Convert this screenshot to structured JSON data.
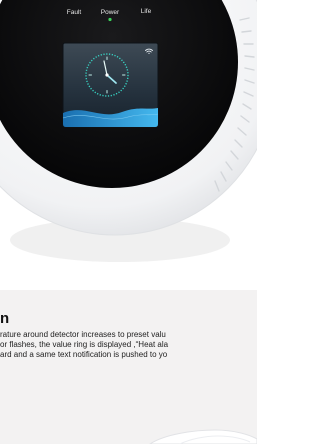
{
  "device": {
    "indicators": [
      {
        "label": "Fault"
      },
      {
        "label": "Power",
        "led_color": "#3bd35a"
      },
      {
        "label": "Life"
      }
    ],
    "screen": {
      "icon": "wifi-icon",
      "clock_icon": "analog-clock-icon"
    },
    "colors": {
      "housing": "#f4f5f7",
      "face": "#0b0b0d",
      "screen_accent": "#1e88c9"
    }
  },
  "info": {
    "title": "n",
    "lines": [
      "rature around detector increases to preset valu",
      "or flashes, the value ring is displayed ,“Heat ala",
      "ard and a same text notification is pushed to yo"
    ]
  }
}
